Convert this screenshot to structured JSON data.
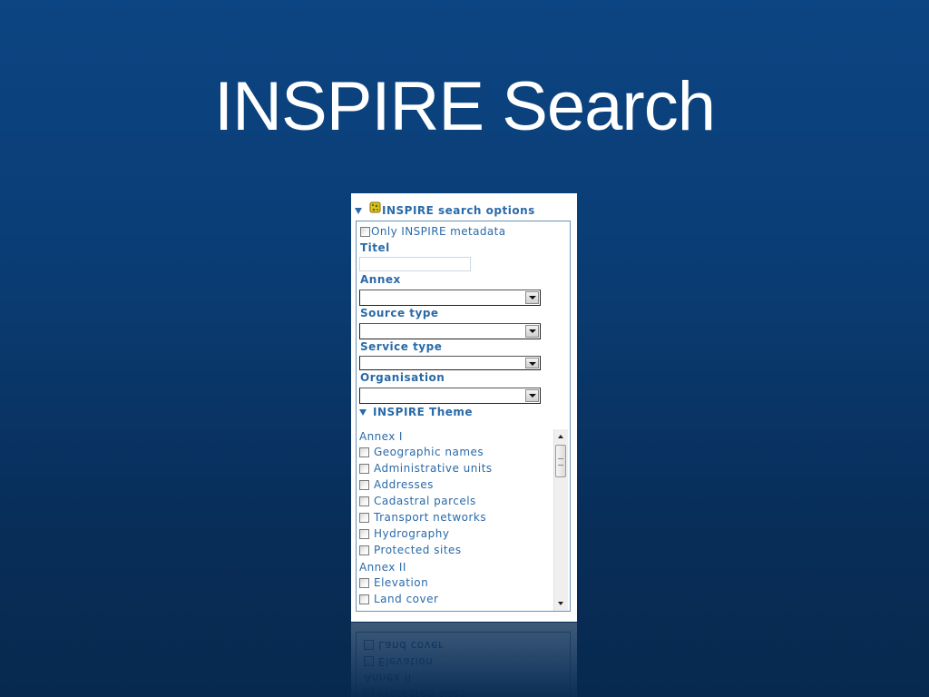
{
  "slide": {
    "title": "INSPIRE Search"
  },
  "panel": {
    "header": "INSPIRE search options",
    "only_inspire_label": "Only INSPIRE metadata",
    "titel_label": "Titel",
    "titel_value": "",
    "annex_label": "Annex",
    "annex_value": "",
    "source_type_label": "Source type",
    "source_type_value": "",
    "service_type_label": "Service type",
    "service_type_value": "",
    "organisation_label": "Organisation",
    "organisation_value": "",
    "theme_header": "INSPIRE Theme",
    "annex_1_label": "Annex I",
    "annex_1_items": [
      "Geographic names",
      "Administrative units",
      "Addresses",
      "Cadastral parcels",
      "Transport networks",
      "Hydrography",
      "Protected sites"
    ],
    "annex_2_label": "Annex II",
    "annex_2_items": [
      "Elevation",
      "Land cover"
    ]
  },
  "reflection": {
    "items": [
      "Land cover",
      "Elevation",
      "Annex II",
      "Protected sites"
    ]
  },
  "colors": {
    "background_top": "#0c4583",
    "background_bottom": "#07294f",
    "link_blue": "#2a6aa8",
    "panel_border": "#6e92b8"
  },
  "icons": {
    "header_icon": "globe-icon",
    "collapse_icon": "triangle-down-icon"
  }
}
